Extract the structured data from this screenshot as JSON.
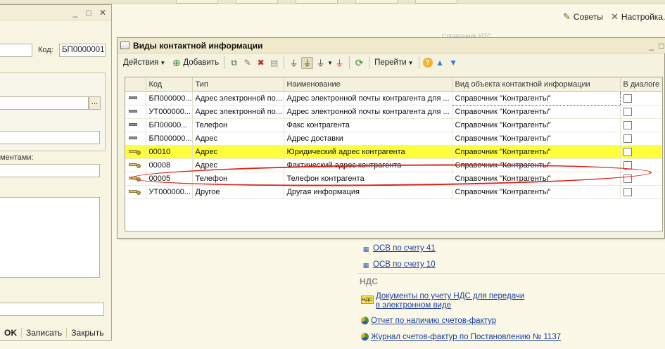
{
  "top": {
    "tips": "Советы",
    "settings": "Настройка..."
  },
  "its_hint": "Справочник ИТС",
  "left_form": {
    "code_label": "Код:",
    "code_value": "БП0000001",
    "elements_label": "ментами:",
    "buttons": {
      "ok": "OK",
      "save": "Записать",
      "close": "Закрыть"
    },
    "browse": "..."
  },
  "window": {
    "title": "Виды контактной информации",
    "toolbar": {
      "actions": "Действия",
      "add": "Добавить",
      "goto": "Перейти"
    },
    "columns": [
      "Код",
      "Тип",
      "Наименование",
      "Вид объекта контактной информации",
      "В диалоге"
    ],
    "rows": [
      {
        "icon": "plain",
        "code": "БП000000...",
        "type": "Адрес электронной по...",
        "name": "Адрес электронной почты контрагента для ...",
        "object": "Справочник \"Контрагенты\"",
        "dialog": false,
        "hl": false,
        "focus": true
      },
      {
        "icon": "plain",
        "code": "УТ000000...",
        "type": "Адрес электронной по...",
        "name": "Адрес электронной почты контрагента для ...",
        "object": "Справочник \"Контрагенты\"",
        "dialog": false,
        "hl": false,
        "focus": false
      },
      {
        "icon": "plain",
        "code": "БП00000...",
        "type": "Телефон",
        "name": "Факс контрагента",
        "object": "Справочник \"Контрагенты\"",
        "dialog": false,
        "hl": false,
        "focus": false
      },
      {
        "icon": "plain",
        "code": "БП000000...",
        "type": "Адрес",
        "name": "Адрес доставки",
        "object": "Справочник \"Контрагенты\"",
        "dialog": false,
        "hl": false,
        "focus": false
      },
      {
        "icon": "pred",
        "code": "00010",
        "type": "Адрес",
        "name": "Юридический адрес контрагента",
        "object": "Справочник \"Контрагенты\"",
        "dialog": false,
        "hl": true,
        "focus": false
      },
      {
        "icon": "pred",
        "code": "00008",
        "type": "Адрес",
        "name": "Фактический адрес контрагента",
        "object": "Справочник \"Контрагенты\"",
        "dialog": false,
        "hl": false,
        "focus": false
      },
      {
        "icon": "pred",
        "code": "00005",
        "type": "Телефон",
        "name": "Телефон контрагента",
        "object": "Справочник \"Контрагенты\"",
        "dialog": false,
        "hl": false,
        "focus": false
      },
      {
        "icon": "pred",
        "code": "УТ000000...",
        "type": "Другое",
        "name": "Другая информация",
        "object": "Справочник \"Контрагенты\"",
        "dialog": false,
        "hl": false,
        "focus": false
      }
    ]
  },
  "links": {
    "osv41": "ОСВ по счету 41",
    "osv10": "ОСВ по счету 10",
    "vat_section": "НДС",
    "vat_badge": "НДС",
    "vat_docs": "Документы по учету НДС для передачи в электронном виде",
    "invoices_report": "Отчет по наличию счетов-фактур",
    "invoices_journal": "Журнал счетов-фактур по Постановлению № 1137"
  }
}
